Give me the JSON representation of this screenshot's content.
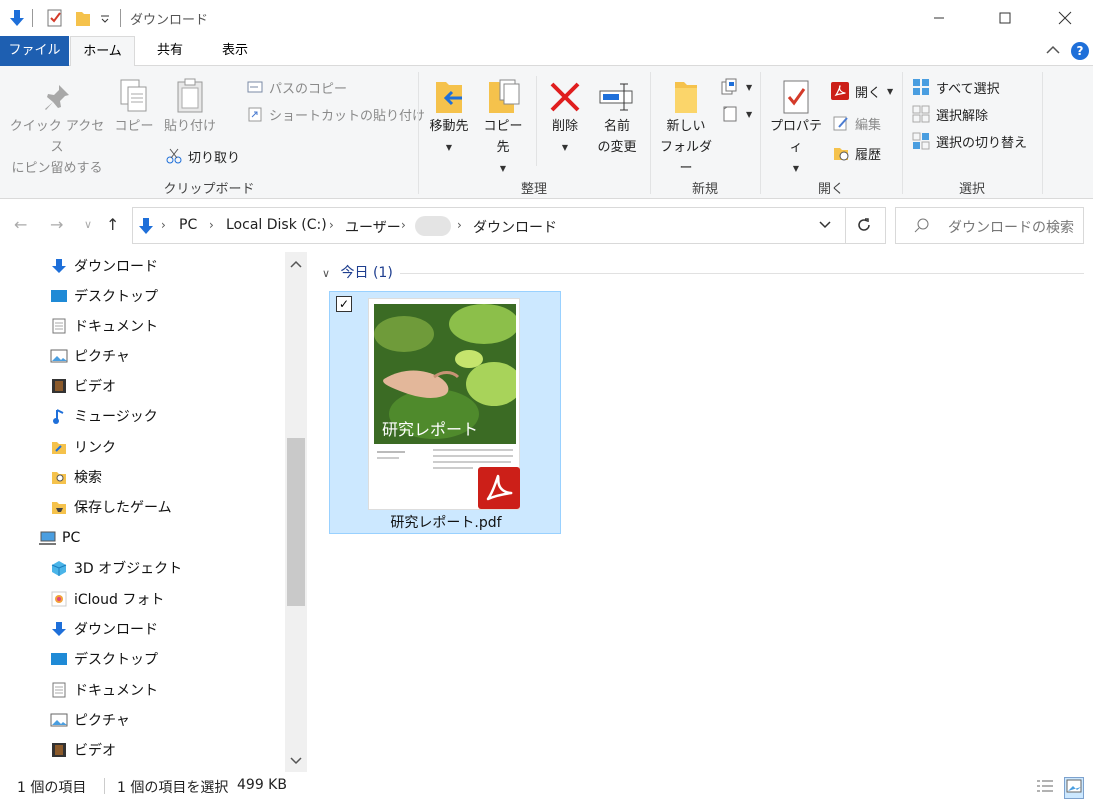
{
  "window": {
    "title": "ダウンロード"
  },
  "tabs": {
    "file": "ファイル",
    "home": "ホーム",
    "share": "共有",
    "view": "表示"
  },
  "ribbon": {
    "clipboard": {
      "label": "クリップボード",
      "pin_line1": "クイック アクセス",
      "pin_line2": "にピン留めする",
      "copy": "コピー",
      "paste": "貼り付け",
      "copy_path": "パスのコピー",
      "paste_shortcut": "ショートカットの貼り付け",
      "cut": "切り取り"
    },
    "organize": {
      "label": "整理",
      "move_to": "移動先",
      "copy_to": "コピー先",
      "delete": "削除",
      "rename_line1": "名前",
      "rename_line2": "の変更"
    },
    "new": {
      "label": "新規",
      "new_folder_line1": "新しい",
      "new_folder_line2": "フォルダー"
    },
    "open": {
      "label": "開く",
      "properties": "プロパティ",
      "open": "開く",
      "edit": "編集",
      "history": "履歴"
    },
    "select": {
      "label": "選択",
      "select_all": "すべて選択",
      "select_none": "選択解除",
      "invert": "選択の切り替え"
    }
  },
  "address": {
    "crumbs": [
      "PC",
      "Local Disk (C:)",
      "ユーザー",
      "ダウンロード"
    ],
    "search_placeholder": "ダウンロードの検索"
  },
  "nav": {
    "items": [
      {
        "label": "ダウンロード",
        "icon": "download-icon"
      },
      {
        "label": "デスクトップ",
        "icon": "desktop-icon"
      },
      {
        "label": "ドキュメント",
        "icon": "document-icon"
      },
      {
        "label": "ピクチャ",
        "icon": "picture-icon"
      },
      {
        "label": "ビデオ",
        "icon": "video-icon"
      },
      {
        "label": "ミュージック",
        "icon": "music-icon"
      },
      {
        "label": "リンク",
        "icon": "link-folder-icon"
      },
      {
        "label": "検索",
        "icon": "search-folder-icon"
      },
      {
        "label": "保存したゲーム",
        "icon": "saved-games-icon"
      },
      {
        "label": "PC",
        "icon": "pc-icon"
      },
      {
        "label": "3D オブジェクト",
        "icon": "3d-objects-icon"
      },
      {
        "label": "iCloud フォト",
        "icon": "icloud-photos-icon"
      },
      {
        "label": "ダウンロード",
        "icon": "download-icon"
      },
      {
        "label": "デスクトップ",
        "icon": "desktop-icon"
      },
      {
        "label": "ドキュメント",
        "icon": "document-icon"
      },
      {
        "label": "ピクチャ",
        "icon": "picture-icon"
      },
      {
        "label": "ビデオ",
        "icon": "video-icon"
      }
    ]
  },
  "content": {
    "group_header": "今日 (1)",
    "file": {
      "name": "研究レポート.pdf",
      "thumb_title": "研究レポート"
    }
  },
  "status": {
    "count": "1 個の項目",
    "selected": "1 個の項目を選択",
    "size": "499 KB"
  },
  "colors": {
    "accent": "#1e5fb1",
    "selection": "#cce8ff",
    "pdf_red": "#cc1f18"
  }
}
